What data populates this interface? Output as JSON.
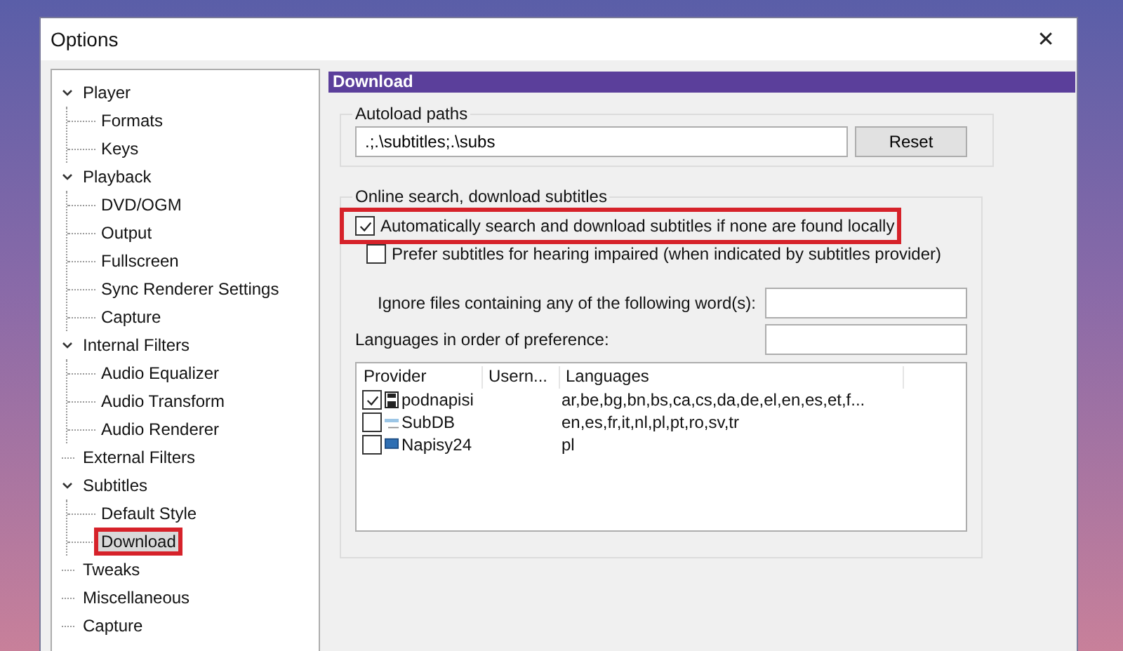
{
  "window": {
    "title": "Options",
    "close": "✕"
  },
  "tree": [
    {
      "label": "Player",
      "expanded": true,
      "selected": false,
      "highlighted": false,
      "children": [
        {
          "label": "Formats",
          "selected": false,
          "highlighted": false
        },
        {
          "label": "Keys",
          "selected": false,
          "highlighted": false
        }
      ]
    },
    {
      "label": "Playback",
      "expanded": true,
      "selected": false,
      "highlighted": false,
      "children": [
        {
          "label": "DVD/OGM",
          "selected": false,
          "highlighted": false
        },
        {
          "label": "Output",
          "selected": false,
          "highlighted": false
        },
        {
          "label": "Fullscreen",
          "selected": false,
          "highlighted": false
        },
        {
          "label": "Sync Renderer Settings",
          "selected": false,
          "highlighted": false
        },
        {
          "label": "Capture",
          "selected": false,
          "highlighted": false
        }
      ]
    },
    {
      "label": "Internal Filters",
      "expanded": true,
      "selected": false,
      "highlighted": false,
      "children": [
        {
          "label": "Audio Equalizer",
          "selected": false,
          "highlighted": false
        },
        {
          "label": "Audio Transform",
          "selected": false,
          "highlighted": false
        },
        {
          "label": "Audio Renderer",
          "selected": false,
          "highlighted": false
        }
      ]
    },
    {
      "label": "External Filters",
      "selected": false,
      "highlighted": false
    },
    {
      "label": "Subtitles",
      "expanded": true,
      "selected": false,
      "highlighted": false,
      "children": [
        {
          "label": "Default Style",
          "selected": false,
          "highlighted": false
        },
        {
          "label": "Download",
          "selected": true,
          "highlighted": true
        }
      ]
    },
    {
      "label": "Tweaks",
      "selected": false,
      "highlighted": false
    },
    {
      "label": "Miscellaneous",
      "selected": false,
      "highlighted": false
    },
    {
      "label": "Capture",
      "selected": false,
      "highlighted": false
    }
  ],
  "page": {
    "title": "Download",
    "autoload": {
      "title": "Autoload paths",
      "value": ".;.\\subtitles;.\\subs",
      "reset": "Reset"
    },
    "online": {
      "title": "Online search, download subtitles",
      "options": [
        {
          "label": "Automatically search and download subtitles if none are found locally",
          "checked": true,
          "highlighted": true
        },
        {
          "label": "Prefer subtitles for hearing impaired (when indicated by subtitles provider)",
          "checked": false,
          "highlighted": false
        }
      ],
      "ignore_label": "Ignore files containing any of the following word(s):",
      "languages_label": "Languages in order of preference:",
      "table": {
        "columns": [
          "Provider",
          "Usern...",
          "Languages"
        ],
        "rows": [
          {
            "checked": true,
            "kind": "disk",
            "provider": "podnapisi",
            "languages": "ar,be,bg,bn,bs,ca,cs,da,de,el,en,es,et,f..."
          },
          {
            "checked": false,
            "kind": "strip",
            "provider": "SubDB",
            "languages": "en,es,fr,it,nl,pl,pt,ro,sv,tr"
          },
          {
            "checked": false,
            "kind": "screen",
            "provider": "Napisy24",
            "languages": "pl"
          }
        ]
      }
    }
  }
}
